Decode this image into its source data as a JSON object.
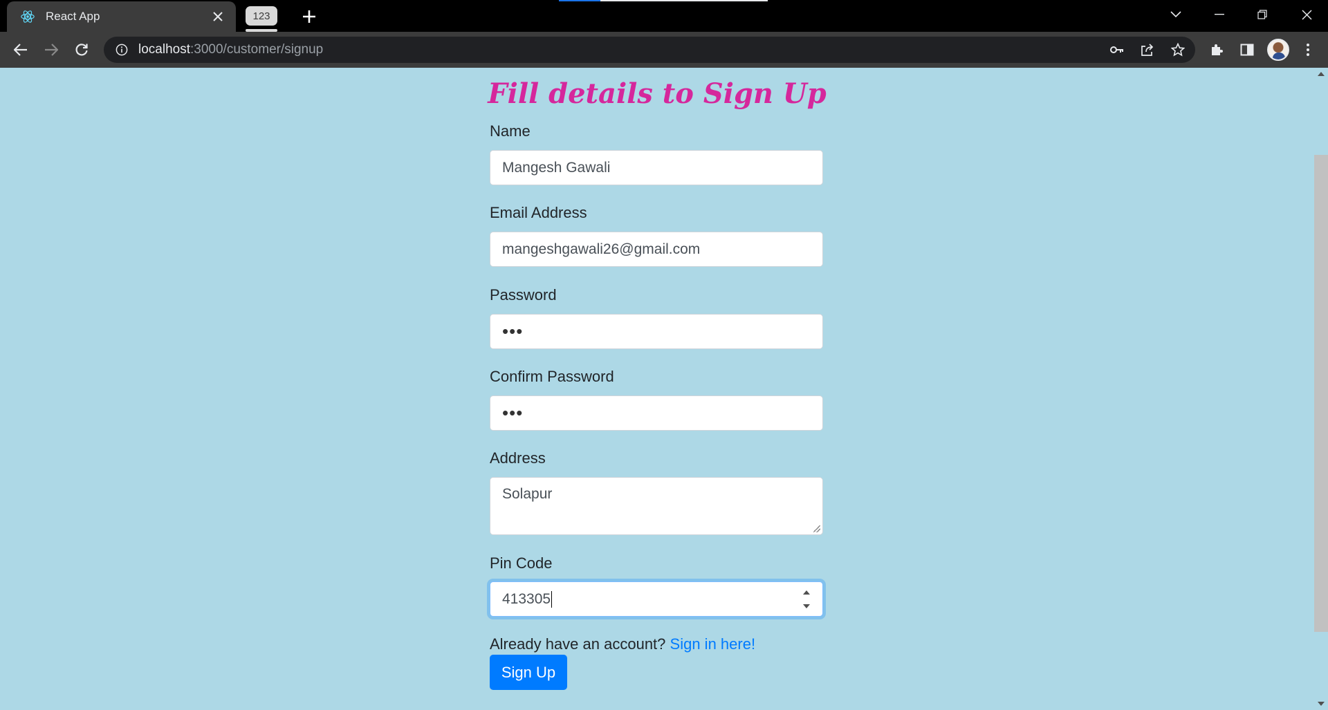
{
  "browser": {
    "tab_title": "React App",
    "tab_group_label": "123",
    "url_host": "localhost",
    "url_path": ":3000/customer/signup"
  },
  "page": {
    "heading": "Fill details to Sign Up"
  },
  "form": {
    "name": {
      "label": "Name",
      "value": "Mangesh Gawali"
    },
    "email": {
      "label": "Email Address",
      "value": "mangeshgawali26@gmail.com"
    },
    "password": {
      "label": "Password",
      "value": "•••"
    },
    "confirm_password": {
      "label": "Confirm Password",
      "value": "•••"
    },
    "address": {
      "label": "Address",
      "value": "Solapur"
    },
    "pincode": {
      "label": "Pin Code",
      "value": "413305"
    },
    "signin_prompt": "Already have an account?",
    "signin_link": "Sign in here!",
    "submit_label": "Sign Up"
  },
  "colors": {
    "page_bg": "#add8e6",
    "heading": "#d5279c",
    "primary": "#007bff"
  },
  "icons": [
    "react-logo-icon",
    "close-icon",
    "plus-icon",
    "back-icon",
    "forward-icon",
    "reload-icon",
    "info-icon",
    "key-icon",
    "share-icon",
    "star-icon",
    "extensions-icon",
    "sidepanel-icon",
    "menu-icon"
  ]
}
